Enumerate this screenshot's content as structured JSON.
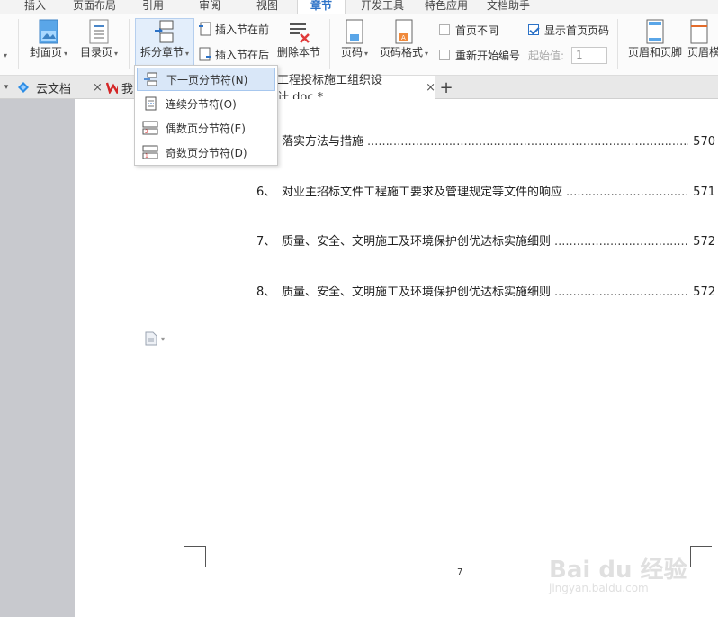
{
  "menu_tabs": [
    "插入",
    "页面布局",
    "引用",
    "审阅",
    "视图",
    "章节",
    "开发工具",
    "特色应用",
    "文档助手"
  ],
  "active_tab_index": 5,
  "ribbon": {
    "cover_page": "封面页",
    "toc_page": "目录页",
    "split_section": "拆分章节",
    "insert_section_before": "插入节在前",
    "insert_section_after": "插入节在后",
    "delete_section": "删除本节",
    "page_number": "页码",
    "page_number_format": "页码格式",
    "first_page_different": "首页不同",
    "first_page_different_checked": false,
    "show_first_page_number": "显示首页页码",
    "show_first_page_number_checked": true,
    "restart_numbering": "重新开始编号",
    "restart_numbering_checked": false,
    "start_value_label": "起始值:",
    "start_value": "1",
    "header_footer": "页眉和页脚",
    "header_horizontal": "页眉横"
  },
  "split_menu": {
    "items": [
      {
        "label": "下一页分节符(N)",
        "highlighted": true
      },
      {
        "label": "连续分节符(O)",
        "highlighted": false
      },
      {
        "label": "偶数页分节符(E)",
        "highlighted": false
      },
      {
        "label": "奇数页分节符(D)",
        "highlighted": false
      }
    ]
  },
  "doc_tabs": {
    "cloud_doc": "云文档",
    "partial_tab": "我",
    "active_doc": "工程投标施工组织设计.doc *",
    "add": "+"
  },
  "toc": [
    {
      "num": "",
      "text": "落实方法与措施",
      "page": "570"
    },
    {
      "num": "6、",
      "text": "对业主招标文件工程施工要求及管理规定等文件的响应",
      "page": "571"
    },
    {
      "num": "7、",
      "text": "质量、安全、文明施工及环境保护创优达标实施细则",
      "page": "572"
    },
    {
      "num": "8、",
      "text": "质量、安全、文明施工及环境保护创优达标实施细则",
      "page": "572"
    }
  ],
  "page_footer_number": "7",
  "watermark": {
    "text": "Bai du 经验",
    "sub": "jingyan.baidu.com"
  },
  "colors": {
    "accent": "#2c72c7",
    "workspace_gray": "#c8c9ce",
    "highlight": "#d9e7f8"
  }
}
